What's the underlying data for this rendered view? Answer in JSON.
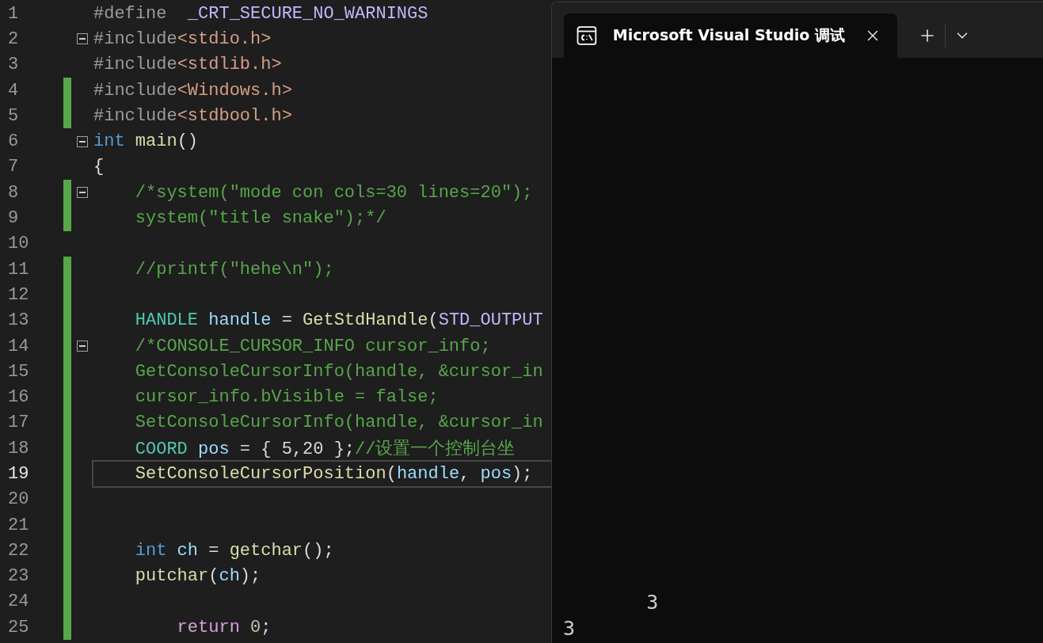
{
  "editor": {
    "lines": [
      {
        "number": "1",
        "changed": false,
        "collapsible": false,
        "current": false,
        "tokens": [
          {
            "kind": "pre",
            "text": "#define"
          },
          {
            "kind": "macro",
            "text": "  _CRT_SECURE_NO_WARNINGS"
          }
        ]
      },
      {
        "number": "2",
        "changed": false,
        "collapsible": true,
        "current": false,
        "tokens": [
          {
            "kind": "pre",
            "text": "#include"
          },
          {
            "kind": "str",
            "text": "<stdio.h>"
          }
        ]
      },
      {
        "number": "3",
        "changed": false,
        "collapsible": false,
        "current": false,
        "tokens": [
          {
            "kind": "pre",
            "text": "#include"
          },
          {
            "kind": "str",
            "text": "<stdlib.h>"
          }
        ]
      },
      {
        "number": "4",
        "changed": true,
        "collapsible": false,
        "current": false,
        "tokens": [
          {
            "kind": "pre",
            "text": "#include"
          },
          {
            "kind": "str",
            "text": "<Windows.h>"
          }
        ]
      },
      {
        "number": "5",
        "changed": true,
        "collapsible": false,
        "current": false,
        "tokens": [
          {
            "kind": "pre",
            "text": "#include"
          },
          {
            "kind": "str",
            "text": "<stdbool.h>"
          }
        ]
      },
      {
        "number": "6",
        "changed": false,
        "collapsible": true,
        "current": false,
        "tokens": [
          {
            "kind": "kw",
            "text": "int"
          },
          {
            "kind": "fn",
            "text": " main"
          },
          {
            "kind": "plain",
            "text": "()"
          }
        ]
      },
      {
        "number": "7",
        "changed": false,
        "collapsible": false,
        "current": false,
        "tokens": [
          {
            "kind": "plain",
            "text": "{"
          }
        ]
      },
      {
        "number": "8",
        "changed": true,
        "collapsible": true,
        "current": false,
        "tokens": [
          {
            "kind": "cm",
            "text": "    /*system(\"mode con cols=30 lines=20\");"
          }
        ]
      },
      {
        "number": "9",
        "changed": true,
        "collapsible": false,
        "current": false,
        "tokens": [
          {
            "kind": "cm",
            "text": "    system(\"title snake\");*/"
          }
        ]
      },
      {
        "number": "10",
        "changed": false,
        "collapsible": false,
        "current": false
      },
      {
        "number": "11",
        "changed": true,
        "collapsible": false,
        "current": false,
        "tokens": [
          {
            "kind": "cm",
            "text": "    //printf(\"hehe\\n\");"
          }
        ]
      },
      {
        "number": "12",
        "changed": true,
        "collapsible": false,
        "current": false
      },
      {
        "number": "13",
        "changed": true,
        "collapsible": false,
        "current": false,
        "tokens": [
          {
            "kind": "type",
            "text": "    HANDLE"
          },
          {
            "kind": "var",
            "text": " handle"
          },
          {
            "kind": "plain",
            "text": " = "
          },
          {
            "kind": "fn",
            "text": "GetStdHandle"
          },
          {
            "kind": "plain",
            "text": "("
          },
          {
            "kind": "macro",
            "text": "STD_OUTPUT"
          }
        ]
      },
      {
        "number": "14",
        "changed": true,
        "collapsible": true,
        "current": false,
        "tokens": [
          {
            "kind": "cm",
            "text": "    /*CONSOLE_CURSOR_INFO cursor_info;"
          }
        ]
      },
      {
        "number": "15",
        "changed": true,
        "collapsible": false,
        "current": false,
        "tokens": [
          {
            "kind": "cm",
            "text": "    GetConsoleCursorInfo(handle, &cursor_in"
          }
        ]
      },
      {
        "number": "16",
        "changed": true,
        "collapsible": false,
        "current": false,
        "tokens": [
          {
            "kind": "cm",
            "text": "    cursor_info.bVisible = false;"
          }
        ]
      },
      {
        "number": "17",
        "changed": true,
        "collapsible": false,
        "current": false,
        "tokens": [
          {
            "kind": "cm",
            "text": "    SetConsoleCursorInfo(handle, &cursor_in"
          }
        ]
      },
      {
        "number": "18",
        "changed": true,
        "collapsible": false,
        "current": false,
        "tokens": [
          {
            "kind": "type",
            "text": "    COORD"
          },
          {
            "kind": "var",
            "text": " pos"
          },
          {
            "kind": "plain",
            "text": " = { 5,20 };"
          },
          {
            "kind": "cm",
            "text": "//设置一个控制台坐"
          }
        ]
      },
      {
        "number": "19",
        "changed": true,
        "collapsible": false,
        "current": true,
        "tokens": [
          {
            "kind": "fn",
            "text": "    SetConsoleCursorPosition"
          },
          {
            "kind": "plain",
            "text": "("
          },
          {
            "kind": "var",
            "text": "handle"
          },
          {
            "kind": "plain",
            "text": ", "
          },
          {
            "kind": "var",
            "text": "pos"
          },
          {
            "kind": "plain",
            "text": ");"
          }
        ]
      },
      {
        "number": "20",
        "changed": true,
        "collapsible": false,
        "current": false
      },
      {
        "number": "21",
        "changed": true,
        "collapsible": false,
        "current": false
      },
      {
        "number": "22",
        "changed": true,
        "collapsible": false,
        "current": false,
        "tokens": [
          {
            "kind": "kw",
            "text": "    int"
          },
          {
            "kind": "var",
            "text": " ch"
          },
          {
            "kind": "plain",
            "text": " = "
          },
          {
            "kind": "fn",
            "text": "getchar"
          },
          {
            "kind": "plain",
            "text": "();"
          }
        ]
      },
      {
        "number": "23",
        "changed": true,
        "collapsible": false,
        "current": false,
        "tokens": [
          {
            "kind": "fn",
            "text": "    putchar"
          },
          {
            "kind": "plain",
            "text": "("
          },
          {
            "kind": "var",
            "text": "ch"
          },
          {
            "kind": "plain",
            "text": ");"
          }
        ]
      },
      {
        "number": "24",
        "changed": true,
        "collapsible": false,
        "current": false
      },
      {
        "number": "25",
        "changed": true,
        "collapsible": false,
        "current": false,
        "tokens": [
          {
            "kind": "ctl",
            "text": "        return"
          },
          {
            "kind": "num",
            "text": " 0"
          },
          {
            "kind": "plain",
            "text": ";"
          }
        ]
      }
    ]
  },
  "terminal": {
    "tab": {
      "title": "Microsoft Visual Studio 调试"
    },
    "output": [
      "       3",
      "3"
    ]
  }
}
